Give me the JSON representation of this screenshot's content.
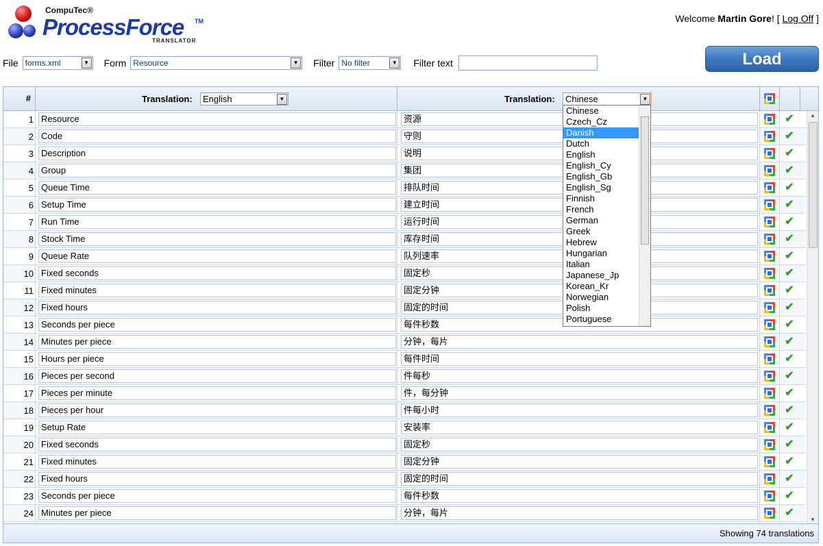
{
  "header": {
    "brand_small": "CompuTec®",
    "brand_main": "ProcessForce",
    "brand_tm": "TM",
    "brand_sub": "TRANSLATOR",
    "welcome_prefix": "Welcome ",
    "user": "Martin Gore",
    "bang": "! [ ",
    "logoff": "Log Off",
    "suffix": " ]"
  },
  "toolbar": {
    "file_label": "File",
    "file_value": "forms.xml",
    "form_label": "Form",
    "form_value": "Resource",
    "filter_label": "Filter",
    "filter_value": "No filter",
    "filter_text_label": "Filter text",
    "filter_text_value": "",
    "load_label": "Load"
  },
  "grid": {
    "num_header": "#",
    "left_label": "Translation:",
    "left_lang": "English",
    "right_label": "Translation:",
    "right_lang": "Chinese",
    "footer": "Showing 74 translations",
    "rows": [
      {
        "n": "1",
        "en": "Resource",
        "zh": "资源"
      },
      {
        "n": "2",
        "en": "Code",
        "zh": "守则"
      },
      {
        "n": "3",
        "en": "Description",
        "zh": "说明"
      },
      {
        "n": "4",
        "en": "Group",
        "zh": "集团"
      },
      {
        "n": "5",
        "en": "Queue Time",
        "zh": "排队时间"
      },
      {
        "n": "6",
        "en": "Setup Time",
        "zh": "建立时间"
      },
      {
        "n": "7",
        "en": "Run Time",
        "zh": "运行时间"
      },
      {
        "n": "8",
        "en": "Stock Time",
        "zh": "库存时间"
      },
      {
        "n": "9",
        "en": "Queue Rate",
        "zh": "队列速率"
      },
      {
        "n": "10",
        "en": "Fixed seconds",
        "zh": "固定秒"
      },
      {
        "n": "11",
        "en": "Fixed minutes",
        "zh": "固定分钟"
      },
      {
        "n": "12",
        "en": "Fixed hours",
        "zh": "固定的时间"
      },
      {
        "n": "13",
        "en": "Seconds per piece",
        "zh": "每件秒数"
      },
      {
        "n": "14",
        "en": "Minutes per piece",
        "zh": "分钟，每片"
      },
      {
        "n": "15",
        "en": "Hours per piece",
        "zh": "每件时间"
      },
      {
        "n": "16",
        "en": "Pieces per second",
        "zh": "件每秒"
      },
      {
        "n": "17",
        "en": "Pieces per minute",
        "zh": "件，每分钟"
      },
      {
        "n": "18",
        "en": "Pieces per hour",
        "zh": "件每小时"
      },
      {
        "n": "19",
        "en": "Setup Rate",
        "zh": "安装率"
      },
      {
        "n": "20",
        "en": "Fixed seconds",
        "zh": "固定秒"
      },
      {
        "n": "21",
        "en": "Fixed minutes",
        "zh": "固定分钟"
      },
      {
        "n": "22",
        "en": "Fixed hours",
        "zh": "固定的时间"
      },
      {
        "n": "23",
        "en": "Seconds per piece",
        "zh": "每件秒数"
      },
      {
        "n": "24",
        "en": "Minutes per piece",
        "zh": "分钟，每片"
      }
    ]
  },
  "dropdown": {
    "selected": "Danish",
    "options": [
      "Chinese",
      "Czech_Cz",
      "Danish",
      "Dutch",
      "English",
      "English_Cy",
      "English_Gb",
      "English_Sg",
      "Finnish",
      "French",
      "German",
      "Greek",
      "Hebrew",
      "Hungarian",
      "Italian",
      "Japanese_Jp",
      "Korean_Kr",
      "Norwegian",
      "Polish",
      "Portuguese"
    ]
  },
  "icons": {
    "google_translate": "google-translate-icon",
    "accept": "checkmark-icon"
  },
  "colors": {
    "accent": "#3e78bf",
    "border": "#9cb8d6",
    "check": "#3a9a2e",
    "selection": "#3399ff"
  }
}
